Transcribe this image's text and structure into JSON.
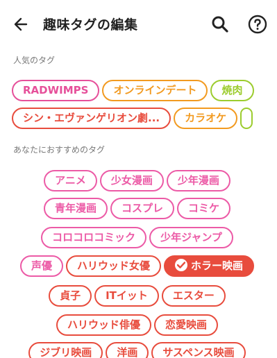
{
  "header": {
    "title": "趣味タグの編集"
  },
  "colors": {
    "popular": [
      "#e6509a",
      "#f29a20",
      "#9ccc2e",
      "#e84c3d"
    ],
    "recommend": "#ec5aa6",
    "red": "#e84c3d",
    "selected_bg": "#e84c3d"
  },
  "popular": {
    "label": "人気のタグ",
    "row1": [
      {
        "label": "RADWIMPS",
        "color": "#e6509a"
      },
      {
        "label": "オンラインデート",
        "color": "#f29a20"
      },
      {
        "label": "焼肉",
        "color": "#9ccc2e"
      }
    ],
    "row2": [
      {
        "label": "シン・エヴァンゲリオン劇...",
        "color": "#e84c3d"
      },
      {
        "label": "カラオケ",
        "color": "#f29a20"
      }
    ]
  },
  "recommend": {
    "label": "あなたにおすすめのタグ",
    "rows": [
      [
        "アニメ",
        "少女漫画",
        "少年漫画"
      ],
      [
        "青年漫画",
        "コスプレ",
        "コミケ"
      ],
      [
        "コロコロコミック",
        "少年ジャンプ"
      ],
      [
        "声優",
        "ハリウッド女優",
        "ホラー映画"
      ],
      [
        "貞子",
        "ITイット",
        "エスター"
      ],
      [
        "ハリウッド俳優",
        "恋愛映画"
      ],
      [
        "ジブリ映画",
        "洋画",
        "サスペンス映画"
      ]
    ],
    "selected": "ホラー映画"
  }
}
